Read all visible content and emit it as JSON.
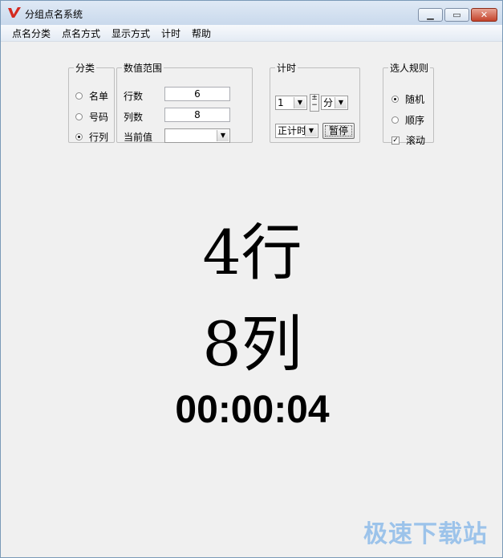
{
  "window": {
    "title": "分组点名系统"
  },
  "menu": [
    "点名分类",
    "点名方式",
    "显示方式",
    "计时",
    "帮助"
  ],
  "category": {
    "legend": "分类",
    "options": [
      {
        "label": "名单",
        "selected": false
      },
      {
        "label": "号码",
        "selected": false
      },
      {
        "label": "行列",
        "selected": true
      }
    ]
  },
  "range": {
    "legend": "数值范围",
    "rows_label": "行数",
    "rows_value": "6",
    "cols_label": "列数",
    "cols_value": "8",
    "current_label": "当前值",
    "current_value": ""
  },
  "timing": {
    "legend": "计时",
    "amount": "1",
    "spin_up": "±",
    "unit": "分",
    "mode": "正计时",
    "pause_button": "暂停"
  },
  "rule": {
    "legend": "选人规则",
    "options": [
      {
        "label": "随机",
        "selected": true
      },
      {
        "label": "顺序",
        "selected": false
      }
    ],
    "scroll_label": "滚动",
    "scroll_checked": true
  },
  "display": {
    "row_result": "4行",
    "col_result": "8列",
    "timer": "00:00:04"
  },
  "watermark": "极速下载站",
  "colors": {
    "close_button": "#c4432b",
    "watermark": "#9cc3ea"
  }
}
